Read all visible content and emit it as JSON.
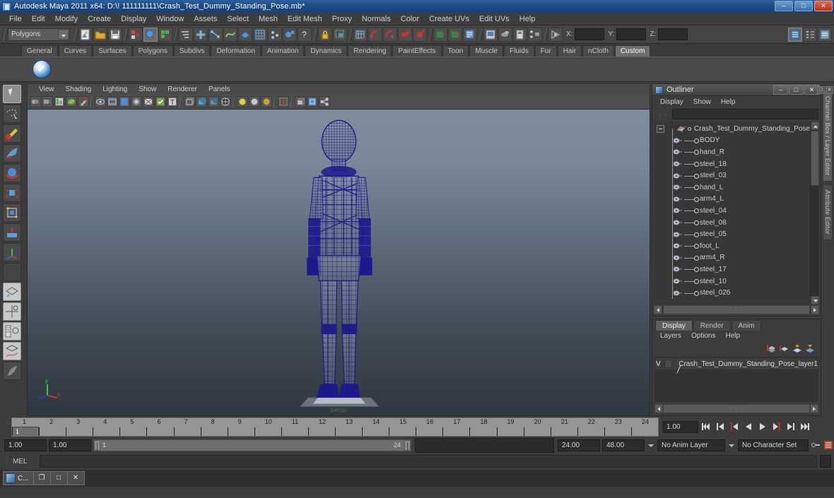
{
  "window": {
    "title": "Autodesk Maya 2011 x64: D:\\! 111111111\\Crash_Test_Dummy_Standing_Pose.mb*",
    "buttons": {
      "minimize": "–",
      "maximize": "□",
      "close": "✕"
    }
  },
  "menubar": {
    "items": [
      "File",
      "Edit",
      "Modify",
      "Create",
      "Display",
      "Window",
      "Assets",
      "Select",
      "Mesh",
      "Edit Mesh",
      "Proxy",
      "Normals",
      "Color",
      "Create UVs",
      "Edit UVs",
      "Help"
    ]
  },
  "toolbar": {
    "menuset": "Polygons",
    "coord_labels": {
      "x": "X:",
      "y": "Y:",
      "z": "Z:"
    },
    "coord_values": {
      "x": "",
      "y": "",
      "z": ""
    }
  },
  "shelf": {
    "tabs": [
      "General",
      "Curves",
      "Surfaces",
      "Polygons",
      "Subdivs",
      "Deformation",
      "Animation",
      "Dynamics",
      "Rendering",
      "PaintEffects",
      "Toon",
      "Muscle",
      "Fluids",
      "Fur",
      "Hair",
      "nCloth",
      "Custom"
    ],
    "active_tab": "Custom"
  },
  "viewport": {
    "menus": [
      "View",
      "Shading",
      "Lighting",
      "Show",
      "Renderer",
      "Panels"
    ],
    "camera_label": "persp",
    "axis": {
      "x": "x",
      "y": "y",
      "z": "z"
    }
  },
  "outliner": {
    "title": "Outliner",
    "menus": [
      "Display",
      "Show",
      "Help"
    ],
    "search_value": "",
    "root": "Crash_Test_Dummy_Standing_Pose",
    "nodes": [
      "BODY",
      "hand_R",
      "steel_18",
      "steel_03",
      "hand_L",
      "arm4_L",
      "steel_04",
      "steel_08",
      "steel_05",
      "foot_L",
      "arm4_R",
      "steel_17",
      "steel_10",
      "steel_026"
    ]
  },
  "layer_editor": {
    "tabs": [
      "Display",
      "Render",
      "Anim"
    ],
    "active_tab": "Display",
    "menus": [
      "Layers",
      "Options",
      "Help"
    ],
    "layers": [
      {
        "visibility": "V",
        "name": "Crash_Test_Dummy_Standing_Pose_layer1"
      }
    ]
  },
  "side_tabs": {
    "items": [
      "Channel Box / Layer Editor",
      "Attribute Editor"
    ],
    "active": "Channel Box / Layer Editor",
    "win_buttons": [
      "□",
      "✕"
    ]
  },
  "timeline": {
    "ticks": [
      "1",
      "2",
      "3",
      "4",
      "5",
      "6",
      "7",
      "8",
      "9",
      "10",
      "11",
      "12",
      "13",
      "14",
      "15",
      "16",
      "17",
      "18",
      "19",
      "20",
      "21",
      "22",
      "23",
      "24"
    ],
    "current_frame_marker": "1",
    "current_frame": "1.00"
  },
  "range": {
    "start_field": "1.00",
    "playback_start_field": "1.00",
    "range_start_label": "1",
    "range_end_label": "24",
    "playback_end_field": "24.00",
    "end_field": "48.00",
    "anim_layer": "No Anim Layer",
    "character_set": "No Character Set"
  },
  "command_line": {
    "label": "MEL",
    "value": ""
  },
  "taskbar": {
    "window_label": "C...",
    "buttons": [
      "❐",
      "□",
      "✕"
    ]
  },
  "colors": {
    "title_bar": "#1d4a85",
    "mesh_wire": "#1a1a8c",
    "panel_bg": "#3c3c3c",
    "viewport_top": "#7e8c9c",
    "viewport_bottom": "#2f3740",
    "accent_axis_x": "#cc2222",
    "accent_axis_y": "#22cc22",
    "accent_axis_z": "#2222cc"
  }
}
